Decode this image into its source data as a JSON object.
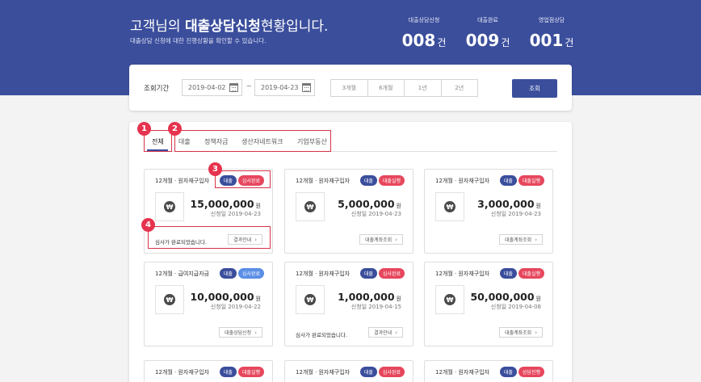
{
  "banner": {
    "title_prefix": "고객님의 ",
    "title_bold": "대출상담신청",
    "title_suffix": "현황입니다.",
    "subtitle": "대출상담 신청에 대한 진행상황을 확인할 수 있습니다.",
    "stats": [
      {
        "label": "대출상담신청",
        "value": "008",
        "unit": "건"
      },
      {
        "label": "대출완료",
        "value": "009",
        "unit": "건"
      },
      {
        "label": "영업점상담",
        "value": "001",
        "unit": "건"
      }
    ]
  },
  "filter": {
    "label": "조회기간",
    "date_from": "2019-04-02",
    "date_to": "2019-04-23",
    "tilde": "~",
    "periods": [
      "3개월",
      "6개월",
      "1년",
      "2년"
    ],
    "search_label": "조회"
  },
  "tabs": [
    "전체",
    "대출",
    "정책자금",
    "생산자네트워크",
    "기업부동산"
  ],
  "markers": [
    "1",
    "2",
    "3",
    "4"
  ],
  "colors": {
    "banner": "#3b4e9c",
    "badge_loan": "#3b4e9c",
    "badge_review_done": "#e6475d",
    "badge_loan_exec": "#e6475d",
    "badge_review_done_blue": "#5b8ee6",
    "badge_consulting": "#e6475d",
    "highlight": "#d6334a"
  },
  "cards": [
    {
      "title": "12개월 · 원자재구입자",
      "badges": [
        {
          "text": "대출",
          "color": "#3b4e9c"
        },
        {
          "text": "심사완료",
          "color": "#e6475d"
        }
      ],
      "icon": "won-icon",
      "amount": "15,000,000",
      "unit": "원",
      "date": "신청일 2019-04-23",
      "message": "심사가 완료되었습니다.",
      "button": "결과안내"
    },
    {
      "title": "12개월 · 원자재구입자",
      "badges": [
        {
          "text": "대출",
          "color": "#3b4e9c"
        },
        {
          "text": "대출실행",
          "color": "#e6475d"
        }
      ],
      "icon": "won-icon",
      "amount": "5,000,000",
      "unit": "원",
      "date": "신청일 2019-04-23",
      "message": "",
      "button": "대출계좌조회"
    },
    {
      "title": "12개월 · 원자재구입자",
      "badges": [
        {
          "text": "대출",
          "color": "#3b4e9c"
        },
        {
          "text": "대출실행",
          "color": "#e6475d"
        }
      ],
      "icon": "won-icon",
      "amount": "3,000,000",
      "unit": "원",
      "date": "신청일 2019-04-23",
      "message": "",
      "button": "대출계좌조회"
    },
    {
      "title": "12개월 · 급여지급자금",
      "badges": [
        {
          "text": "대출",
          "color": "#3b4e9c"
        },
        {
          "text": "심사완료",
          "color": "#5b8ee6"
        }
      ],
      "icon": "won-icon",
      "amount": "10,000,000",
      "unit": "원",
      "date": "신청일 2019-04-22",
      "message": "",
      "button": "대출상담신청"
    },
    {
      "title": "12개월 · 원자재구입자",
      "badges": [
        {
          "text": "대출",
          "color": "#3b4e9c"
        },
        {
          "text": "심사완료",
          "color": "#e6475d"
        }
      ],
      "icon": "won-icon",
      "amount": "1,000,000",
      "unit": "원",
      "date": "신청일 2019-04-15",
      "message": "심사가 완료되었습니다.",
      "button": "결과안내"
    },
    {
      "title": "12개월 · 원자재구입자",
      "badges": [
        {
          "text": "대출",
          "color": "#3b4e9c"
        },
        {
          "text": "대출실행",
          "color": "#e6475d"
        }
      ],
      "icon": "won-icon",
      "amount": "50,000,000",
      "unit": "원",
      "date": "신청일 2019-04-08",
      "message": "",
      "button": "대출계좌조회"
    },
    {
      "title": "12개월 · 원자재구입자",
      "badges": [
        {
          "text": "대출",
          "color": "#3b4e9c"
        },
        {
          "text": "대출실행",
          "color": "#e6475d"
        }
      ],
      "icon": "won-icon",
      "amount": "",
      "unit": "",
      "date": "",
      "message": "",
      "button": ""
    },
    {
      "title": "12개월 · 원자재구입자",
      "badges": [
        {
          "text": "대출",
          "color": "#3b4e9c"
        },
        {
          "text": "심사완료",
          "color": "#e6475d"
        }
      ],
      "icon": "won-icon",
      "amount": "",
      "unit": "",
      "date": "",
      "message": "",
      "button": ""
    },
    {
      "title": "12개월 · 원자재구입자",
      "badges": [
        {
          "text": "대출",
          "color": "#3b4e9c"
        },
        {
          "text": "상담진행",
          "color": "#e6475d"
        }
      ],
      "icon": "won-icon",
      "amount": "",
      "unit": "",
      "date": "",
      "message": "",
      "button": ""
    }
  ]
}
